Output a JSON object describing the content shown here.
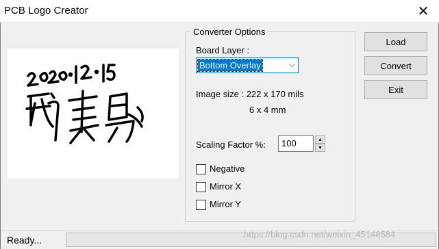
{
  "window": {
    "title": "PCB Logo Creator",
    "close_glyph": "✕"
  },
  "preview": {
    "signature_date": "2020.12.15",
    "signature_name": "郑东鹏",
    "ink_color": "#000000"
  },
  "options": {
    "group_title": "Converter Options",
    "board_layer_label": "Board Layer :",
    "board_layer_value": "Bottom Overlay",
    "image_size_label": "Image size : 222 x 170 mils",
    "image_size_mm": "6 x 4 mm",
    "scaling_label": "Scaling Factor %:",
    "scaling_value": "100",
    "checkboxes": [
      {
        "label": "Negative",
        "checked": false
      },
      {
        "label": "Mirror X",
        "checked": false
      },
      {
        "label": "Mirror Y",
        "checked": false
      }
    ]
  },
  "buttons": {
    "load": "Load",
    "convert": "Convert",
    "exit": "Exit"
  },
  "status": {
    "text": "Ready...",
    "progress": 0,
    "watermark": "https://blog.csdn.net/weixin_45148584"
  },
  "colors": {
    "accent": "#0078d7",
    "window_bg": "#f0f0f0",
    "progress_green": "#06b025"
  },
  "icons": {
    "close": "close-icon",
    "dropdown": "chevron-down-icon",
    "spin_up": "spin-up-icon",
    "spin_down": "spin-down-icon"
  }
}
